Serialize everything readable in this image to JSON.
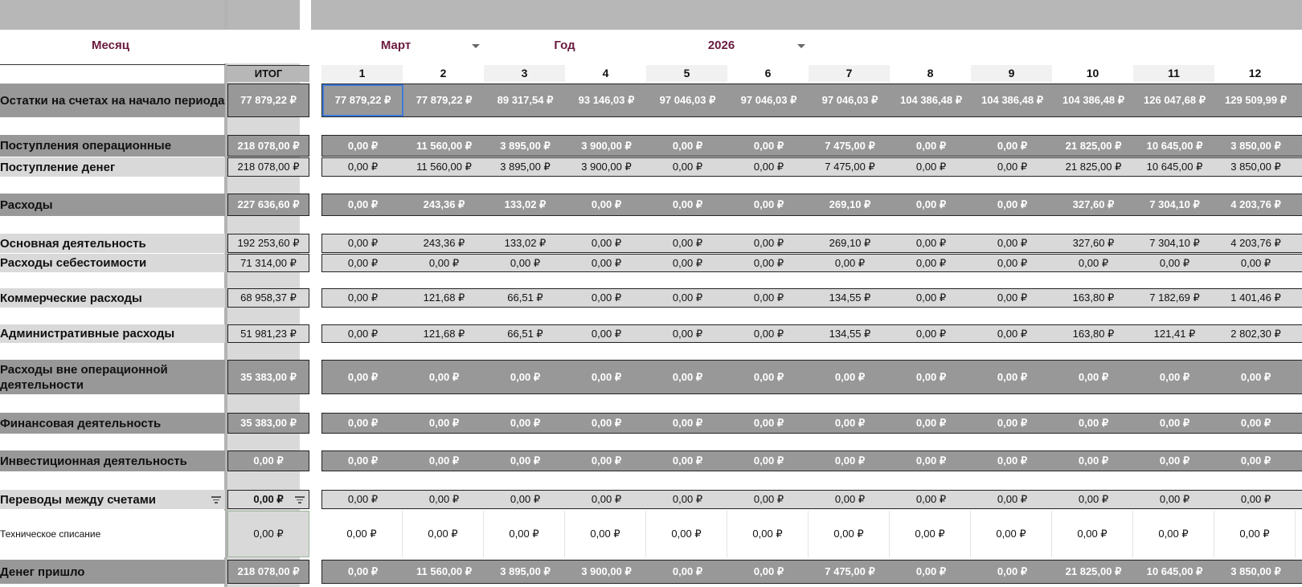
{
  "header": {
    "month_label": "Месяц",
    "month_value": "Март",
    "year_label": "Год",
    "year_value": "2026",
    "total_label": "ИТОГ"
  },
  "days": [
    "1",
    "2",
    "3",
    "4",
    "5",
    "6",
    "7",
    "8",
    "9",
    "10",
    "11",
    "12"
  ],
  "rows": [
    {
      "label": "Остатки на счетах на начало периода",
      "total": "77 879,22 ₽",
      "values": [
        "77 879,22 ₽",
        "77 879,22 ₽",
        "89 317,54 ₽",
        "93 146,03 ₽",
        "97 046,03 ₽",
        "97 046,03 ₽",
        "97 046,03 ₽",
        "104 386,48 ₽",
        "104 386,48 ₽",
        "104 386,48 ₽",
        "126 047,68 ₽",
        "129 509,99 ₽"
      ]
    },
    {
      "label": "Поступления операционные",
      "total": "218 078,00 ₽",
      "values": [
        "0,00 ₽",
        "11 560,00 ₽",
        "3 895,00 ₽",
        "3 900,00 ₽",
        "0,00 ₽",
        "0,00 ₽",
        "7 475,00 ₽",
        "0,00 ₽",
        "0,00 ₽",
        "21 825,00 ₽",
        "10 645,00 ₽",
        "3 850,00 ₽"
      ]
    },
    {
      "label": "Поступление денег",
      "total": "218 078,00 ₽",
      "values": [
        "0,00 ₽",
        "11 560,00 ₽",
        "3 895,00 ₽",
        "3 900,00 ₽",
        "0,00 ₽",
        "0,00 ₽",
        "7 475,00 ₽",
        "0,00 ₽",
        "0,00 ₽",
        "21 825,00 ₽",
        "10 645,00 ₽",
        "3 850,00 ₽"
      ]
    },
    {
      "label": "Расходы",
      "total": "227 636,60 ₽",
      "values": [
        "0,00 ₽",
        "243,36 ₽",
        "133,02 ₽",
        "0,00 ₽",
        "0,00 ₽",
        "0,00 ₽",
        "269,10 ₽",
        "0,00 ₽",
        "0,00 ₽",
        "327,60 ₽",
        "7 304,10 ₽",
        "4 203,76 ₽"
      ]
    },
    {
      "label": "Основная деятельность",
      "total": "192 253,60 ₽",
      "values": [
        "0,00 ₽",
        "243,36 ₽",
        "133,02 ₽",
        "0,00 ₽",
        "0,00 ₽",
        "0,00 ₽",
        "269,10 ₽",
        "0,00 ₽",
        "0,00 ₽",
        "327,60 ₽",
        "7 304,10 ₽",
        "4 203,76 ₽"
      ]
    },
    {
      "label": "Расходы себестоимости",
      "total": "71 314,00 ₽",
      "values": [
        "0,00 ₽",
        "0,00 ₽",
        "0,00 ₽",
        "0,00 ₽",
        "0,00 ₽",
        "0,00 ₽",
        "0,00 ₽",
        "0,00 ₽",
        "0,00 ₽",
        "0,00 ₽",
        "0,00 ₽",
        "0,00 ₽"
      ]
    },
    {
      "label": "Коммерческие расходы",
      "total": "68 958,37 ₽",
      "values": [
        "0,00 ₽",
        "121,68 ₽",
        "66,51 ₽",
        "0,00 ₽",
        "0,00 ₽",
        "0,00 ₽",
        "134,55 ₽",
        "0,00 ₽",
        "0,00 ₽",
        "163,80 ₽",
        "7 182,69 ₽",
        "1 401,46 ₽"
      ]
    },
    {
      "label": "Административные расходы",
      "total": "51 981,23 ₽",
      "values": [
        "0,00 ₽",
        "121,68 ₽",
        "66,51 ₽",
        "0,00 ₽",
        "0,00 ₽",
        "0,00 ₽",
        "134,55 ₽",
        "0,00 ₽",
        "0,00 ₽",
        "163,80 ₽",
        "121,41 ₽",
        "2 802,30 ₽"
      ]
    },
    {
      "label": "Расходы вне операционной деятельности",
      "total": "35 383,00 ₽",
      "values": [
        "0,00 ₽",
        "0,00 ₽",
        "0,00 ₽",
        "0,00 ₽",
        "0,00 ₽",
        "0,00 ₽",
        "0,00 ₽",
        "0,00 ₽",
        "0,00 ₽",
        "0,00 ₽",
        "0,00 ₽",
        "0,00 ₽"
      ]
    },
    {
      "label": "Финансовая деятельность",
      "total": "35 383,00 ₽",
      "values": [
        "0,00 ₽",
        "0,00 ₽",
        "0,00 ₽",
        "0,00 ₽",
        "0,00 ₽",
        "0,00 ₽",
        "0,00 ₽",
        "0,00 ₽",
        "0,00 ₽",
        "0,00 ₽",
        "0,00 ₽",
        "0,00 ₽"
      ]
    },
    {
      "label": "Инвестиционная деятельность",
      "total": "0,00 ₽",
      "values": [
        "0,00 ₽",
        "0,00 ₽",
        "0,00 ₽",
        "0,00 ₽",
        "0,00 ₽",
        "0,00 ₽",
        "0,00 ₽",
        "0,00 ₽",
        "0,00 ₽",
        "0,00 ₽",
        "0,00 ₽",
        "0,00 ₽"
      ]
    },
    {
      "label": "Переводы между счетами",
      "total": "0,00 ₽",
      "values": [
        "0,00 ₽",
        "0,00 ₽",
        "0,00 ₽",
        "0,00 ₽",
        "0,00 ₽",
        "0,00 ₽",
        "0,00 ₽",
        "0,00 ₽",
        "0,00 ₽",
        "0,00 ₽",
        "0,00 ₽",
        "0,00 ₽"
      ]
    },
    {
      "label": "Техническое списание",
      "total": "0,00 ₽",
      "values": [
        "0,00 ₽",
        "0,00 ₽",
        "0,00 ₽",
        "0,00 ₽",
        "0,00 ₽",
        "0,00 ₽",
        "0,00 ₽",
        "0,00 ₽",
        "0,00 ₽",
        "0,00 ₽",
        "0,00 ₽",
        "0,00 ₽"
      ]
    },
    {
      "label": "Денег пришло",
      "total": "218 078,00 ₽",
      "values": [
        "0,00 ₽",
        "11 560,00 ₽",
        "3 895,00 ₽",
        "3 900,00 ₽",
        "0,00 ₽",
        "0,00 ₽",
        "7 475,00 ₽",
        "0,00 ₽",
        "0,00 ₽",
        "21 825,00 ₽",
        "10 645,00 ₽",
        "3 850,00 ₽"
      ]
    }
  ],
  "colors": {
    "header_text": "#6b1b3f",
    "dark_row": "#989898",
    "light_row": "#d9d9d9",
    "selection": "#3d7bd9"
  }
}
